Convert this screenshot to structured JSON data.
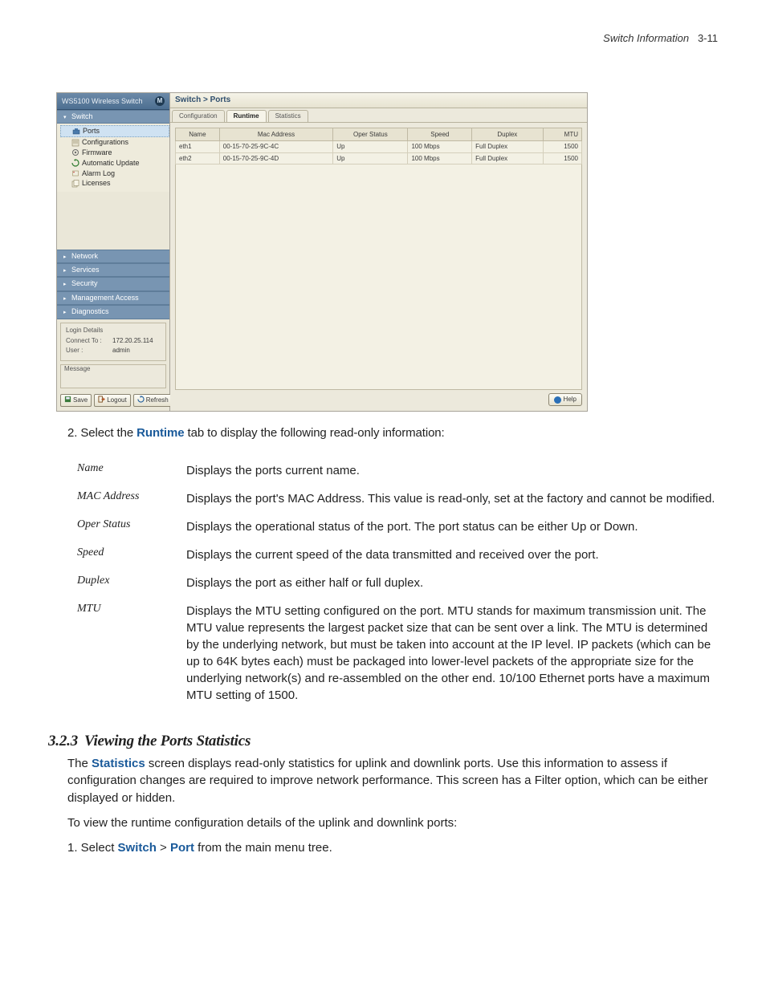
{
  "page_header": {
    "title": "Switch Information",
    "page_num": "3-11"
  },
  "app": {
    "brand": "WS5100 Wireless Switch",
    "logo_glyph": "M",
    "nav": {
      "switch": {
        "label": "Switch",
        "children": [
          {
            "label": "Ports",
            "icon": "ports-icon",
            "selected": true
          },
          {
            "label": "Configurations",
            "icon": "config-icon"
          },
          {
            "label": "Firmware",
            "icon": "firmware-icon"
          },
          {
            "label": "Automatic Update",
            "icon": "update-icon"
          },
          {
            "label": "Alarm Log",
            "icon": "alarm-icon"
          },
          {
            "label": "Licenses",
            "icon": "license-icon"
          }
        ]
      },
      "others": [
        {
          "label": "Network"
        },
        {
          "label": "Services"
        },
        {
          "label": "Security"
        },
        {
          "label": "Management Access"
        },
        {
          "label": "Diagnostics"
        }
      ]
    },
    "login": {
      "title": "Login Details",
      "connect_label": "Connect To :",
      "connect_value": "172.20.25.114",
      "user_label": "User :",
      "user_value": "admin"
    },
    "message_label": "Message",
    "buttons": {
      "save": "Save",
      "logout": "Logout",
      "refresh": "Refresh"
    },
    "crumb": "Switch > Ports",
    "tabs": [
      {
        "label": "Configuration",
        "active": false
      },
      {
        "label": "Runtime",
        "active": true
      },
      {
        "label": "Statistics",
        "active": false
      }
    ],
    "table": {
      "headers": [
        "Name",
        "Mac Address",
        "Oper Status",
        "Speed",
        "Duplex",
        "MTU"
      ],
      "rows": [
        {
          "name": "eth1",
          "mac": "00-15-70-25-9C-4C",
          "oper": "Up",
          "speed": "100 Mbps",
          "duplex": "Full Duplex",
          "mtu": "1500"
        },
        {
          "name": "eth2",
          "mac": "00-15-70-25-9C-4D",
          "oper": "Up",
          "speed": "100 Mbps",
          "duplex": "Full Duplex",
          "mtu": "1500"
        }
      ]
    },
    "help_label": "Help"
  },
  "doc": {
    "step2_prefix": "2. Select the ",
    "step2_kw": "Runtime",
    "step2_suffix": " tab to display the following read-only information:",
    "defs": [
      {
        "term": "Name",
        "desc": "Displays the ports current name."
      },
      {
        "term": "MAC Address",
        "desc": "Displays the port's MAC Address. This value is read-only, set at the factory and cannot be modified."
      },
      {
        "term": "Oper Status",
        "desc": "Displays the operational status of the port. The port status can be either Up or Down."
      },
      {
        "term": "Speed",
        "desc": "Displays the current speed of the data transmitted and received over the port."
      },
      {
        "term": "Duplex",
        "desc": "Displays the port as either half or full duplex."
      },
      {
        "term": "MTU",
        "desc": "Displays the MTU setting configured on the port. MTU stands for maximum transmission unit. The MTU value represents the largest packet size that can be sent over a link. The MTU is determined by the underlying network, but must be taken into account at the IP level. IP packets (which can be up to 64K bytes each) must be packaged into lower-level packets of the appropriate size for the underlying network(s) and re-assembled on the other end. 10/100 Ethernet ports have a maximum MTU setting of 1500."
      }
    ],
    "section": {
      "num": "3.2.3",
      "title": "Viewing the Ports Statistics"
    },
    "stats_para_pre": "The ",
    "stats_kw": "Statistics",
    "stats_para_post": " screen displays read-only statistics for uplink and downlink ports. Use this information to assess if configuration changes are required to improve network performance. This screen has a Filter option, which can be either displayed or hidden.",
    "runtime_line": "To view the runtime configuration details of the uplink and downlink ports:",
    "step1_prefix": "1. Select ",
    "step1_kw1": "Switch",
    "step1_gt": " > ",
    "step1_kw2": "Port",
    "step1_suffix": " from the main menu tree."
  }
}
